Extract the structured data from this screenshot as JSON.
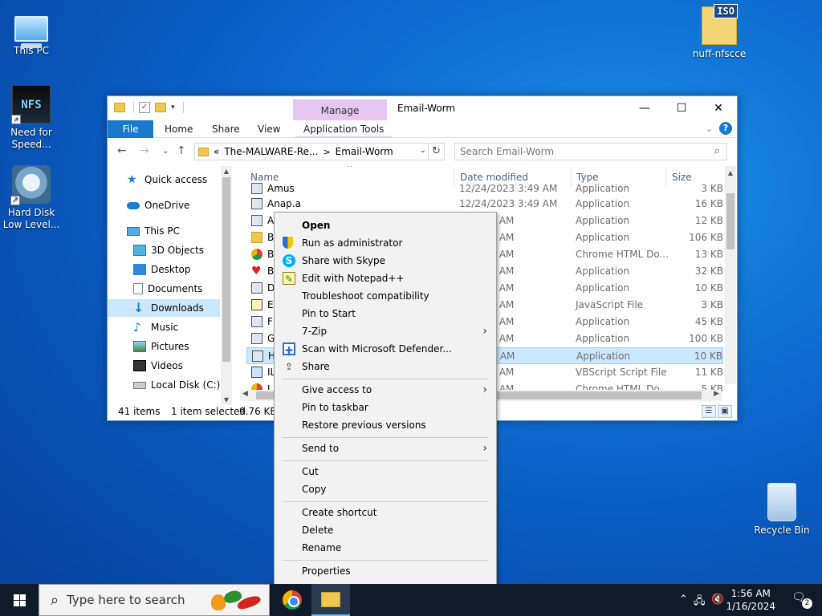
{
  "desktop": {
    "icons": [
      {
        "label": "This PC"
      },
      {
        "label": "Need for Speed...",
        "art": "NFS"
      },
      {
        "label": "Hard Disk Low Level..."
      },
      {
        "label": "nuff-nfscce",
        "badge": "ISO"
      },
      {
        "label": "Recycle Bin"
      }
    ]
  },
  "explorer": {
    "title": "Email-Worm",
    "manage_tab": "Manage",
    "ribbon_tabs": [
      "File",
      "Home",
      "Share",
      "View",
      "Application Tools"
    ],
    "address": {
      "prefix": "«",
      "crumbs": [
        "The-MALWARE-Re...",
        "Email-Worm"
      ],
      "separator": ">"
    },
    "search_placeholder": "Search Email-Worm",
    "nav": [
      {
        "label": "Quick access",
        "icon": "star-icon"
      },
      {
        "label": "OneDrive",
        "icon": "cloud-icon"
      },
      {
        "label": "This PC",
        "icon": "computer-icon"
      },
      {
        "label": "3D Objects",
        "icon": "cube-icon"
      },
      {
        "label": "Desktop",
        "icon": "desktop-icon"
      },
      {
        "label": "Documents",
        "icon": "document-icon"
      },
      {
        "label": "Downloads",
        "icon": "download-icon",
        "selected": true
      },
      {
        "label": "Music",
        "icon": "music-icon"
      },
      {
        "label": "Pictures",
        "icon": "pictures-icon"
      },
      {
        "label": "Videos",
        "icon": "videos-icon"
      },
      {
        "label": "Local Disk (C:)",
        "icon": "disk-icon"
      }
    ],
    "columns": [
      "Name",
      "Date modified",
      "Type",
      "Size"
    ],
    "files": [
      {
        "name": "Amus",
        "date": "12/24/2023 3:49 AM",
        "type": "Application",
        "size": "3 KB",
        "icon": "app"
      },
      {
        "name": "Anap.a",
        "date": "12/24/2023 3:49 AM",
        "type": "Application",
        "size": "16 KB",
        "icon": "app"
      },
      {
        "name": "A",
        "date": "23 3:49 AM",
        "type": "Application",
        "size": "12 KB",
        "icon": "app"
      },
      {
        "name": "B",
        "date": "23 3:49 AM",
        "type": "Application",
        "size": "106 KB",
        "icon": "folder"
      },
      {
        "name": "B",
        "date": "23 3:49 AM",
        "type": "Chrome HTML Do...",
        "size": "13 KB",
        "icon": "chrome"
      },
      {
        "name": "B",
        "date": "23 3:49 AM",
        "type": "Application",
        "size": "32 KB",
        "icon": "heart"
      },
      {
        "name": "D",
        "date": "23 3:49 AM",
        "type": "Application",
        "size": "10 KB",
        "icon": "app"
      },
      {
        "name": "E",
        "date": "23 3:49 AM",
        "type": "JavaScript File",
        "size": "3 KB",
        "icon": "js"
      },
      {
        "name": "F",
        "date": "23 3:49 AM",
        "type": "Application",
        "size": "45 KB",
        "icon": "app"
      },
      {
        "name": "G",
        "date": "23 3:49 AM",
        "type": "Application",
        "size": "100 KB",
        "icon": "app"
      },
      {
        "name": "H",
        "date": "23 3:49 AM",
        "type": "Application",
        "size": "10 KB",
        "icon": "app",
        "selected": true
      },
      {
        "name": "IL",
        "date": "23 3:49 AM",
        "type": "VBScript Script File",
        "size": "11 KB",
        "icon": "vbs"
      },
      {
        "name": "I",
        "date": "23 3:49 AM",
        "type": "Chrome HTML Do...",
        "size": "5 KB",
        "icon": "chrome"
      }
    ],
    "status": {
      "items": "41 items",
      "selected": "1 item selected",
      "size": "9.76 KB"
    }
  },
  "context_menu": {
    "groups": [
      [
        {
          "label": "Open",
          "bold": true
        },
        {
          "label": "Run as administrator",
          "icon": "shield-icon"
        },
        {
          "label": "Share with Skype",
          "icon": "skype-icon"
        },
        {
          "label": "Edit with Notepad++",
          "icon": "notepad-icon"
        },
        {
          "label": "Troubleshoot compatibility"
        },
        {
          "label": "Pin to Start"
        },
        {
          "label": "7-Zip",
          "submenu": true
        },
        {
          "label": "Scan with Microsoft Defender...",
          "icon": "defender-icon"
        },
        {
          "label": "Share",
          "icon": "share-icon"
        }
      ],
      [
        {
          "label": "Give access to",
          "submenu": true
        },
        {
          "label": "Pin to taskbar"
        },
        {
          "label": "Restore previous versions"
        }
      ],
      [
        {
          "label": "Send to",
          "submenu": true
        }
      ],
      [
        {
          "label": "Cut"
        },
        {
          "label": "Copy"
        }
      ],
      [
        {
          "label": "Create shortcut"
        },
        {
          "label": "Delete"
        },
        {
          "label": "Rename"
        }
      ],
      [
        {
          "label": "Properties"
        }
      ]
    ]
  },
  "taskbar": {
    "search_placeholder": "Type here to search",
    "time": "1:56 AM",
    "date": "1/16/2024",
    "notifications": "2"
  }
}
